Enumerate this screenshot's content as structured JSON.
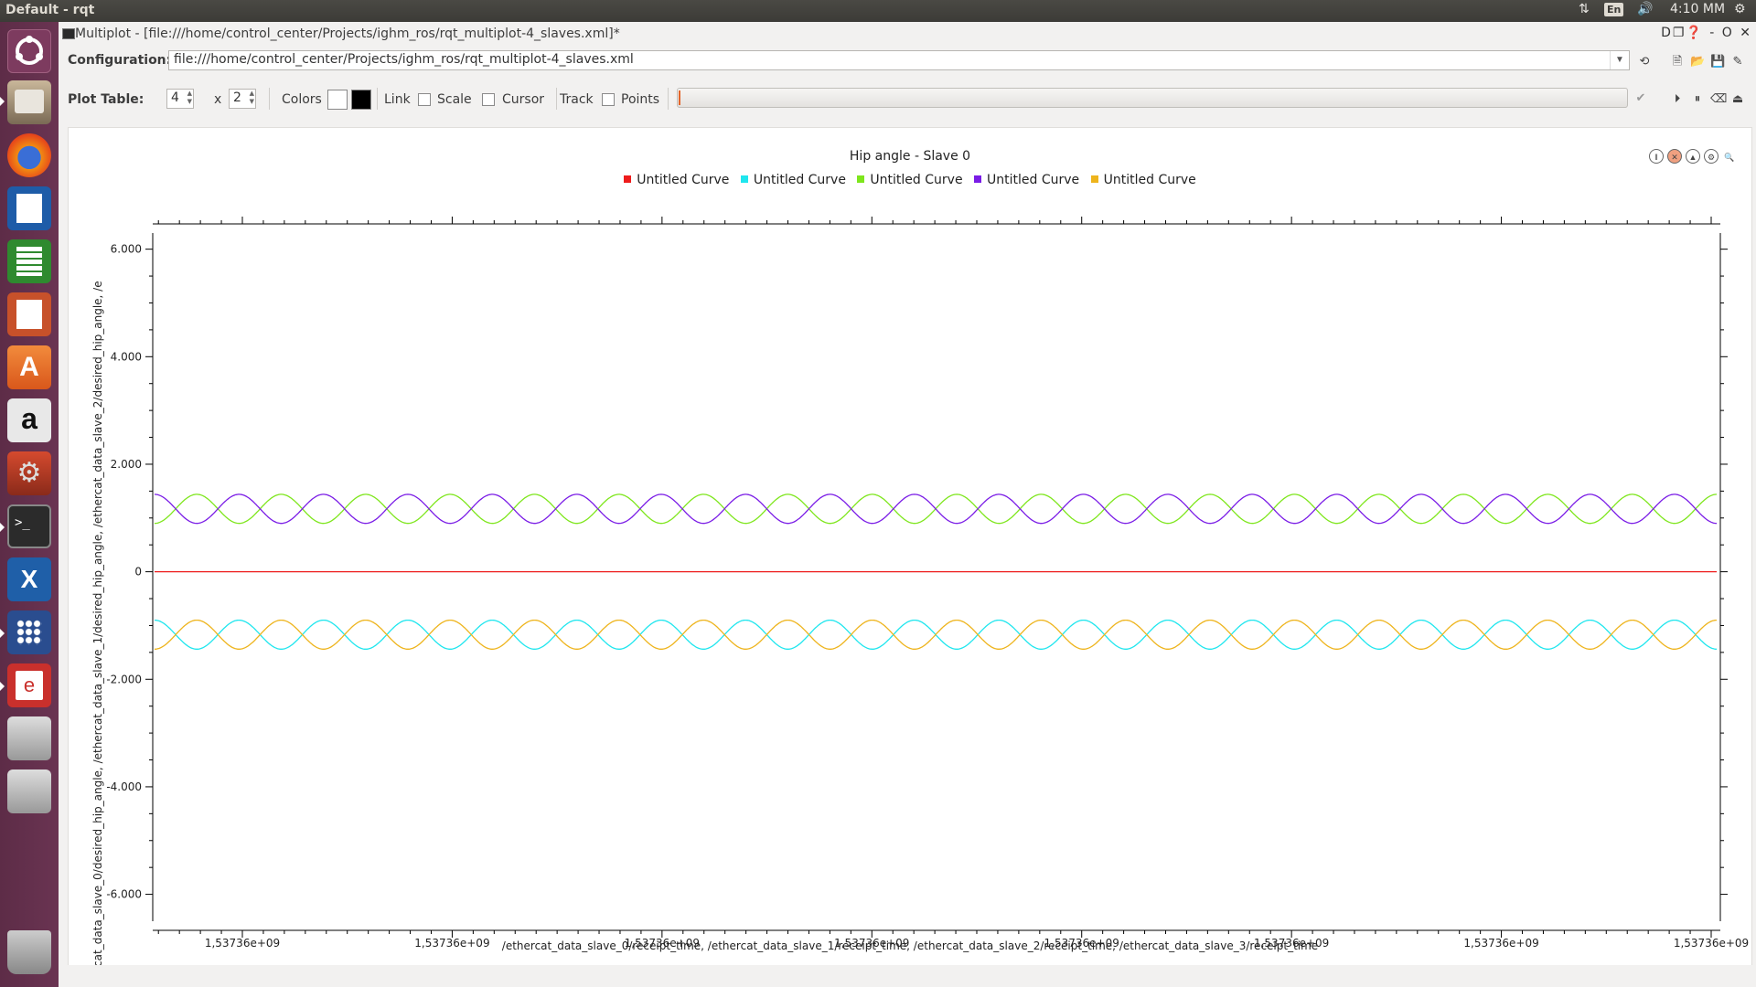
{
  "topbar": {
    "title": "Default - rqt",
    "lang": "En",
    "clock": "4:10 MM"
  },
  "window": {
    "title": "Multiplot - [file:///home/control_center/Projects/ighm_ros/rqt_multiplot-4_slaves.xml]*",
    "controls": "D❐❓ - O ✕"
  },
  "config": {
    "label": "Configuration:",
    "value": "file:///home/control_center/Projects/ighm_ros/rqt_multiplot-4_slaves.xml"
  },
  "toolbar": {
    "plot_table_label": "Plot Table:",
    "rows": "4",
    "x_sep": "x",
    "cols": "2",
    "colors_label": "Colors",
    "link_label": "Link",
    "scale_label": "Scale",
    "cursor_label": "Cursor",
    "track_label": "Track",
    "points_label": "Points",
    "progress": 0.002
  },
  "launcher": {
    "icons": [
      "ubuntu-dash-icon",
      "files-icon",
      "firefox-icon",
      "writer-icon",
      "calc-icon",
      "impress-icon",
      "software-center-icon",
      "amazon-icon",
      "system-settings-icon",
      "terminal-icon",
      "vscode-icon",
      "app-grid-icon",
      "evince-icon",
      "drive-icon",
      "drive-icon",
      "trash-icon"
    ]
  },
  "chart_data": {
    "type": "line",
    "title": "Hip angle - Slave 0",
    "xlabel": "/ethercat_data_slave_0/receipt_time, /ethercat_data_slave_1/receipt_time, /ethercat_data_slave_2/receipt_time, /ethercat_data_slave_3/receipt_time",
    "ylabel": "rcat_data_slave_0/desired_hip_angle, /ethercat_data_slave_1/desired_hip_angle, /ethercat_data_slave_2/desired_hip_angle, /e",
    "ylim": [
      -6.5,
      6.3
    ],
    "yticks": [
      6,
      4,
      2,
      0,
      -2,
      -4,
      -6
    ],
    "ytick_labels": [
      "6.000",
      "4.000",
      "2.000",
      "0",
      "-2.000",
      "-4.000",
      "-6.000"
    ],
    "xtick_labels": [
      "1,53736e+09",
      "1,53736e+09",
      "1,53736e+09",
      "1,53736e+09",
      "1,53736e+09",
      "1,53736e+09",
      "1,53736e+09",
      "1,53736e+09"
    ],
    "periods": 18.5,
    "series": [
      {
        "name": "Untitled Curve",
        "color": "#ee1c1c",
        "center": 0,
        "amplitude": 0,
        "phase": 0
      },
      {
        "name": "Untitled Curve",
        "color": "#1fe6ee",
        "center": -1.17,
        "amplitude": 0.27,
        "phase": 1.5708
      },
      {
        "name": "Untitled Curve",
        "color": "#7ee61c",
        "center": 1.17,
        "amplitude": 0.27,
        "phase": -1.5708
      },
      {
        "name": "Untitled Curve",
        "color": "#7a1ce6",
        "center": 1.17,
        "amplitude": 0.27,
        "phase": 1.5708
      },
      {
        "name": "Untitled Curve",
        "color": "#eeb41c",
        "center": -1.17,
        "amplitude": 0.27,
        "phase": -1.5708
      }
    ]
  }
}
